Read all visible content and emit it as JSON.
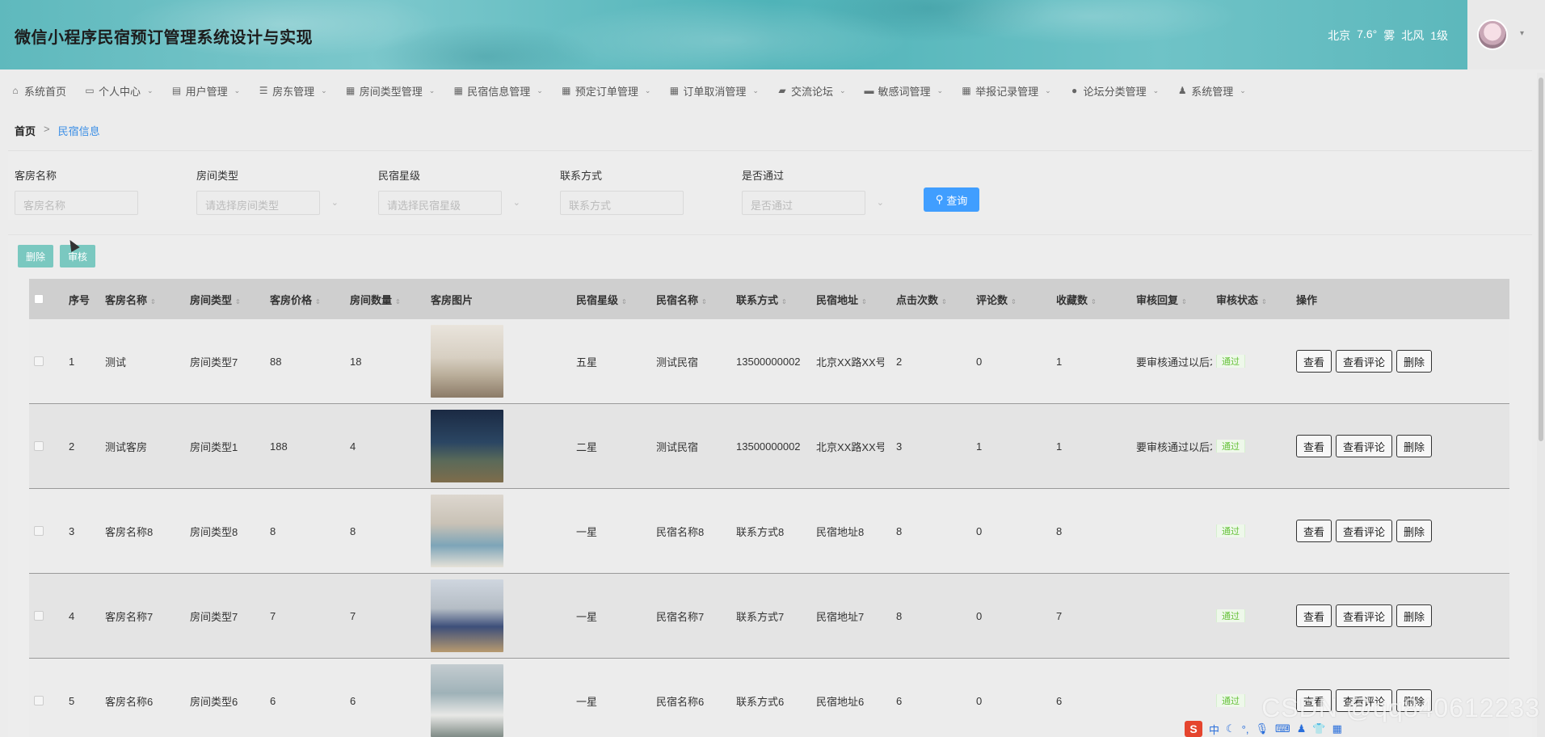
{
  "header": {
    "title": "微信小程序民宿预订管理系统设计与实现",
    "weather": [
      "北京",
      "7.6°",
      "雾",
      "北风",
      "1级"
    ]
  },
  "nav": [
    {
      "icon": "home-icon",
      "glyph": "⌂",
      "label": "系统首页",
      "caret": false
    },
    {
      "icon": "user-card-icon",
      "glyph": "▭",
      "label": "个人中心",
      "caret": true
    },
    {
      "icon": "clipboard-icon",
      "glyph": "▤",
      "label": "用户管理",
      "caret": true
    },
    {
      "icon": "menu-lines-icon",
      "glyph": "☰",
      "label": "房东管理",
      "caret": true
    },
    {
      "icon": "grid-icon",
      "glyph": "▦",
      "label": "房间类型管理",
      "caret": true
    },
    {
      "icon": "grid-icon",
      "glyph": "▦",
      "label": "民宿信息管理",
      "caret": true
    },
    {
      "icon": "grid-icon",
      "glyph": "▦",
      "label": "预定订单管理",
      "caret": true
    },
    {
      "icon": "grid-icon",
      "glyph": "▦",
      "label": "订单取消管理",
      "caret": true
    },
    {
      "icon": "chat-icon",
      "glyph": "▰",
      "label": "交流论坛",
      "caret": true
    },
    {
      "icon": "message-icon",
      "glyph": "▬",
      "label": "敏感词管理",
      "caret": true
    },
    {
      "icon": "grid-icon",
      "glyph": "▦",
      "label": "举报记录管理",
      "caret": true
    },
    {
      "icon": "location-icon",
      "glyph": "●",
      "label": "论坛分类管理",
      "caret": true
    },
    {
      "icon": "person-icon",
      "glyph": "♟",
      "label": "系统管理",
      "caret": true
    }
  ],
  "breadcrumb": {
    "home": "首页",
    "separator": ">",
    "current": "民宿信息"
  },
  "search": {
    "room_name": {
      "label": "客房名称",
      "placeholder": "客房名称"
    },
    "room_type": {
      "label": "房间类型",
      "placeholder": "请选择房间类型"
    },
    "star": {
      "label": "民宿星级",
      "placeholder": "请选择民宿星级"
    },
    "contact": {
      "label": "联系方式",
      "placeholder": "联系方式"
    },
    "passed": {
      "label": "是否通过",
      "placeholder": "是否通过"
    },
    "query_label": "查询"
  },
  "actions": {
    "delete": "删除",
    "audit": "审核"
  },
  "table": {
    "headers": {
      "index": "序号",
      "room_name": "客房名称",
      "room_type": "房间类型",
      "price": "客房价格",
      "count": "房间数量",
      "image": "客房图片",
      "star": "民宿星级",
      "bnb_name": "民宿名称",
      "contact": "联系方式",
      "address": "民宿地址",
      "clicks": "点击次数",
      "comments": "评论数",
      "favorites": "收藏数",
      "reply": "审核回复",
      "status": "审核状态",
      "ops": "操作"
    },
    "op_labels": {
      "view": "查看",
      "view_comments": "查看评论",
      "delete": "删除"
    },
    "rows": [
      {
        "index": "1",
        "room_name": "测试",
        "room_type": "房间类型7",
        "price": "88",
        "count": "18",
        "star": "五星",
        "bnb_name": "测试民宿",
        "contact": "13500000002",
        "address": "北京XX路XX号",
        "clicks": "2",
        "comments": "0",
        "favorites": "1",
        "reply": "要审核通过以后才",
        "status": "通过"
      },
      {
        "index": "2",
        "room_name": "测试客房",
        "room_type": "房间类型1",
        "price": "188",
        "count": "4",
        "star": "二星",
        "bnb_name": "测试民宿",
        "contact": "13500000002",
        "address": "北京XX路XX号",
        "clicks": "3",
        "comments": "1",
        "favorites": "1",
        "reply": "要审核通过以后才",
        "status": "通过"
      },
      {
        "index": "3",
        "room_name": "客房名称8",
        "room_type": "房间类型8",
        "price": "8",
        "count": "8",
        "star": "一星",
        "bnb_name": "民宿名称8",
        "contact": "联系方式8",
        "address": "民宿地址8",
        "clicks": "8",
        "comments": "0",
        "favorites": "8",
        "reply": "",
        "status": "通过"
      },
      {
        "index": "4",
        "room_name": "客房名称7",
        "room_type": "房间类型7",
        "price": "7",
        "count": "7",
        "star": "一星",
        "bnb_name": "民宿名称7",
        "contact": "联系方式7",
        "address": "民宿地址7",
        "clicks": "8",
        "comments": "0",
        "favorites": "7",
        "reply": "",
        "status": "通过"
      },
      {
        "index": "5",
        "room_name": "客房名称6",
        "room_type": "房间类型6",
        "price": "6",
        "count": "6",
        "star": "一星",
        "bnb_name": "民宿名称6",
        "contact": "联系方式6",
        "address": "民宿地址6",
        "clicks": "6",
        "comments": "0",
        "favorites": "6",
        "reply": "",
        "status": "通过"
      }
    ]
  },
  "watermark": "CSDN @qq840612233",
  "ime": {
    "logo": "S",
    "lang": "中"
  }
}
